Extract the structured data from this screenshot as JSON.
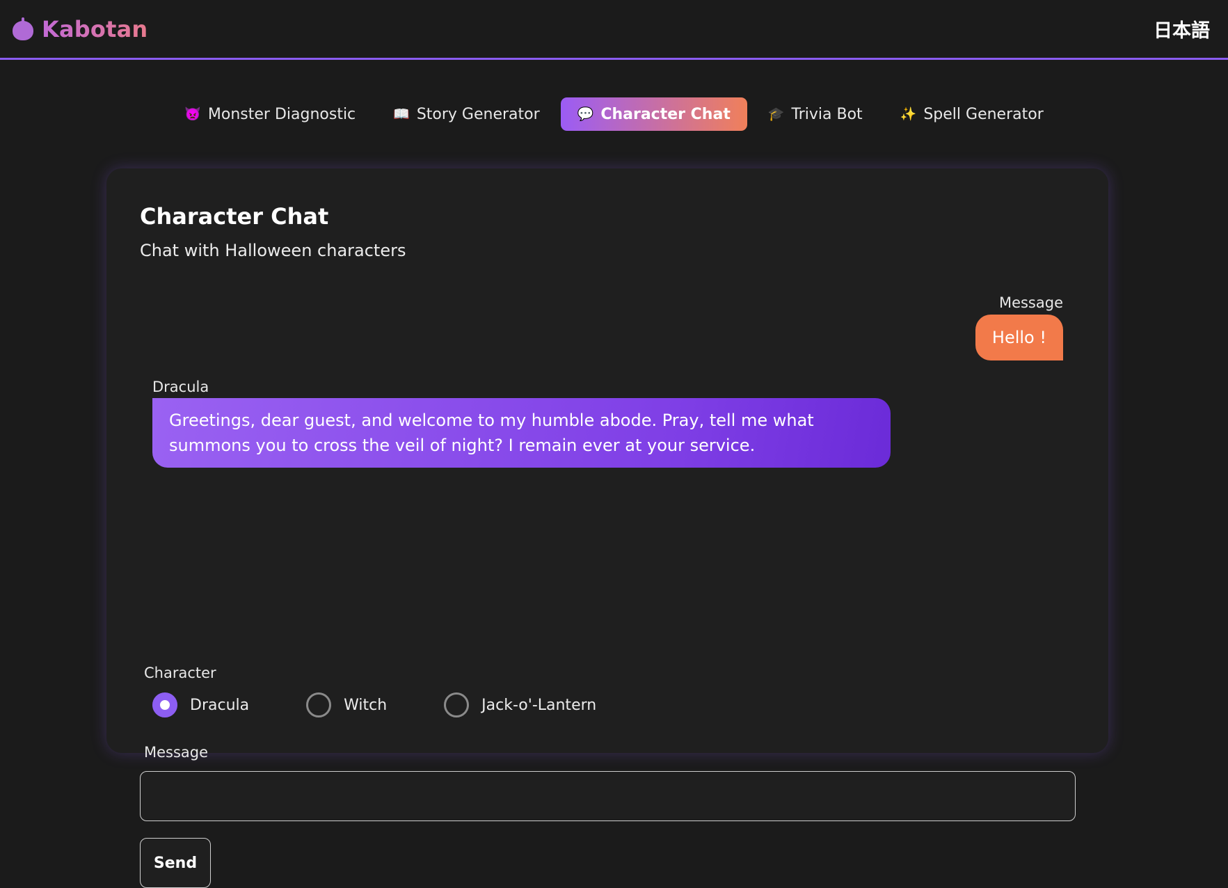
{
  "header": {
    "brand": "Kabotan",
    "brand_icon": "pumpkin-icon",
    "language_toggle": "日本語"
  },
  "tabs": [
    {
      "icon": "👿",
      "label": "Monster Diagnostic",
      "active": false
    },
    {
      "icon": "📖",
      "label": "Story Generator",
      "active": false
    },
    {
      "icon": "💬",
      "label": "Character Chat",
      "active": true
    },
    {
      "icon": "🎓",
      "label": "Trivia Bot",
      "active": false
    },
    {
      "icon": "✨",
      "label": "Spell Generator",
      "active": false
    }
  ],
  "card": {
    "title": "Character Chat",
    "subtitle": "Chat with Halloween characters"
  },
  "chat": {
    "user_label": "Message",
    "user_message": "Hello !",
    "bot_label": "Dracula",
    "bot_message": "Greetings, dear guest, and welcome to my humble abode. Pray, tell me what summons you to cross the veil of night? I remain ever at your service."
  },
  "character": {
    "label": "Character",
    "options": [
      "Dracula",
      "Witch",
      "Jack-o'-Lantern"
    ],
    "selected": "Dracula"
  },
  "message_input": {
    "label": "Message",
    "value": "",
    "placeholder": ""
  },
  "send_button": "Send",
  "colors": {
    "background": "#1b1b1b",
    "accent_purple": "#8a5cf0",
    "accent_orange": "#f27a4a"
  }
}
